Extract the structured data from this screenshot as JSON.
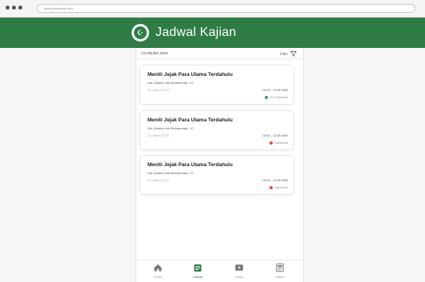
{
  "browser": {
    "url": "www.wordpress.com"
  },
  "header": {
    "title": "Jadwal Kajian"
  },
  "toolbar": {
    "date": "24 Oktober 2022",
    "filter_label": "Filter"
  },
  "cards": [
    {
      "title": "Meniti Jejak Para Ulama Terdahulu",
      "speaker": "Ust. Ibrahim bin Muhammad, LC",
      "date": "24, Maret 2022",
      "time": "13:00 - 14:00 WIB",
      "status": "On Schedule",
      "status_color": "#2f9e57"
    },
    {
      "title": "Meniti Jejak Para Ulama Terdahulu",
      "speaker": "Ust. Ibrahim bin Muhammad, LC",
      "date": "24, Maret 2022",
      "time": "13:00 - 14:00 WIB",
      "status": "Canceled",
      "status_color": "#e04848"
    },
    {
      "title": "Meniti Jejak Para Ulama Terdahulu",
      "speaker": "Ust. Ibrahim bin Muhammad, LC",
      "date": "24, Maret 2022",
      "time": "13:00 - 14:00 WIB",
      "status": "Canceled",
      "status_color": "#e04848"
    }
  ],
  "nav": [
    {
      "label": "Home",
      "icon": "home-icon"
    },
    {
      "label": "Jadwal",
      "icon": "calendar-icon",
      "active": true
    },
    {
      "label": "Video",
      "icon": "video-icon"
    },
    {
      "label": "Artikel",
      "icon": "article-icon"
    }
  ],
  "colors": {
    "brand": "#2f7d45",
    "on_schedule": "#2f9e57",
    "canceled": "#e04848"
  }
}
